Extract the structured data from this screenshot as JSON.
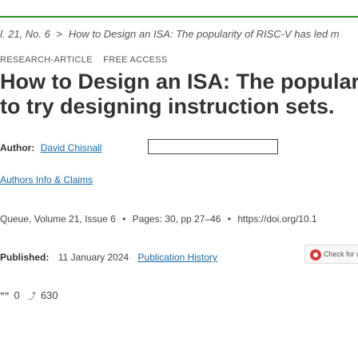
{
  "breadcrumb": {
    "issue": "l. 21, No. 6",
    "separator": ">",
    "article": "How to Design an ISA: The popularity of RISC-V has led m"
  },
  "badges": {
    "type": "RESEARCH-ARTICLE",
    "access": "FREE ACCESS"
  },
  "article": {
    "title": "How to Design an ISA: The popular to try designing instruction sets."
  },
  "author": {
    "label": "Author:",
    "name": "David Chisnall"
  },
  "authors_link": "Authors Info & Claims",
  "citation": {
    "journal": "Queue, Volume 21, Issue 6",
    "pages": "Pages: 30, pp 27–46",
    "doi": "https://doi.org/10.1",
    "bullet": "•"
  },
  "published": {
    "label": "Published:",
    "date": "11 January 2024",
    "history_link": "Publication History"
  },
  "check_updates": {
    "label": "Check for up"
  },
  "metrics": {
    "citations_icon": "quote-icon",
    "citations": "0",
    "downloads_icon": "trend-icon",
    "downloads": "630"
  },
  "colors": {
    "accent_bar": "#2d8d2d",
    "link": "#1a6aa8"
  }
}
